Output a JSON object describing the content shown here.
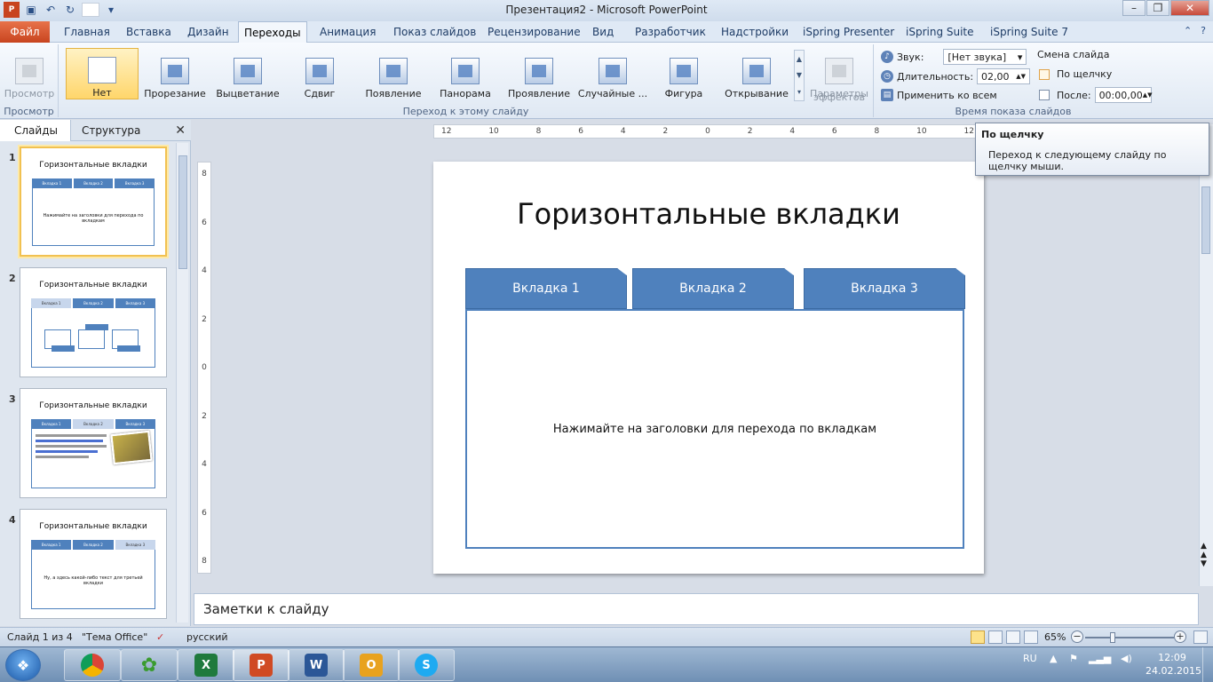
{
  "window": {
    "title": "Презентация2 - Microsoft PowerPoint"
  },
  "ribbon_tabs": {
    "file": "Файл",
    "items": [
      "Главная",
      "Вставка",
      "Дизайн",
      "Переходы",
      "Анимация",
      "Показ слайдов",
      "Рецензирование",
      "Вид",
      "Разработчик",
      "Надстройки",
      "iSpring Presenter",
      "iSpring Suite",
      "iSpring Suite 7"
    ],
    "active_index": 3
  },
  "ribbon": {
    "preview_group": {
      "button_label": "Просмотр",
      "group_label": "Просмотр"
    },
    "transition_group": {
      "label": "Переход к этому слайду",
      "buttons": [
        "Нет",
        "Прорезание",
        "Выцветание",
        "Сдвиг",
        "Появление",
        "Панорама",
        "Проявление",
        "Случайные ...",
        "Фигура",
        "Открывание"
      ],
      "selected_index": 0,
      "effects_label_line1": "Параметры",
      "effects_label_line2": "эффектов"
    },
    "timing_group": {
      "label": "Время показа слайдов",
      "sound_label": "Звук:",
      "sound_value": "[Нет звука]",
      "duration_label": "Длительность:",
      "duration_value": "02,00",
      "apply_all_label": "Применить ко всем",
      "advance_label": "Смена слайда",
      "on_click_label": "По щелчку",
      "on_click_checked": true,
      "after_label": "После:",
      "after_checked": false,
      "after_value": "00:00,00"
    }
  },
  "left_pane": {
    "tabs": [
      "Слайды",
      "Структура"
    ],
    "active_tab": 0,
    "slides": [
      {
        "num": "1",
        "title": "Горизонтальные вкладки",
        "tabs": [
          "Вкладка 1",
          "Вкладка 2",
          "Вкладка 3"
        ],
        "body": "Нажимайте на заголовки для перехода по вкладкам"
      },
      {
        "num": "2",
        "title": "Горизонтальные вкладки",
        "tabs": [
          "Вкладка 1",
          "Вкладка 2",
          "Вкладка 3"
        ],
        "body": ""
      },
      {
        "num": "3",
        "title": "Горизонтальные вкладки",
        "tabs": [
          "Вкладка 1",
          "Вкладка 2",
          "Вкладка 3"
        ],
        "body": ""
      },
      {
        "num": "4",
        "title": "Горизонтальные вкладки",
        "tabs": [
          "Вкладка 1",
          "Вкладка 2",
          "Вкладка 3"
        ],
        "body": "Ну, а здесь какой-либо текст для третьей вкладки"
      }
    ]
  },
  "slide": {
    "title": "Горизонтальные вкладки",
    "tabs": [
      "Вкладка 1",
      "Вкладка 2",
      "Вкладка 3"
    ],
    "body_text": "Нажимайте на заголовки для перехода по вкладкам"
  },
  "rulers": {
    "horizontal": [
      "12",
      "10",
      "8",
      "6",
      "4",
      "2",
      "0",
      "2",
      "4",
      "6",
      "8",
      "10",
      "12"
    ],
    "vertical": [
      "8",
      "6",
      "4",
      "2",
      "0",
      "2",
      "4",
      "6",
      "8"
    ]
  },
  "tooltip": {
    "title": "По щелчку",
    "body": "Переход к следующему слайду по щелчку мыши."
  },
  "notes": {
    "placeholder": "Заметки к слайду"
  },
  "status": {
    "slide_info": "Слайд 1 из 4",
    "theme": "\"Тема Office\"",
    "language": "русский",
    "zoom": "65%"
  },
  "taskbar": {
    "lang": "RU",
    "time": "12:09",
    "date": "24.02.2015"
  }
}
